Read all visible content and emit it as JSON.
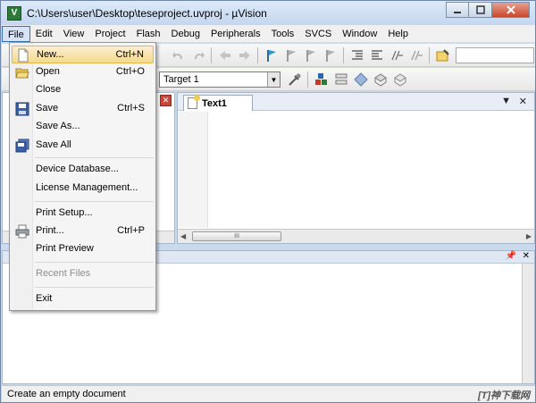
{
  "window": {
    "title": "C:\\Users\\user\\Desktop\\teseproject.uvproj - µVision",
    "app_icon_letter": "V"
  },
  "menubar": {
    "items": [
      "File",
      "Edit",
      "View",
      "Project",
      "Flash",
      "Debug",
      "Peripherals",
      "Tools",
      "SVCS",
      "Window",
      "Help"
    ],
    "active": "File"
  },
  "toolbar2": {
    "target": "Target 1"
  },
  "editor": {
    "tab_label": "Text1",
    "tab_menu_glyph": "▼",
    "tab_close_glyph": "✕",
    "scroll_thumb_grip": "III"
  },
  "file_menu": {
    "items": [
      {
        "label": "New...",
        "shortcut": "Ctrl+N",
        "icon": "new-file-icon",
        "highlighted": true
      },
      {
        "label": "Open",
        "shortcut": "Ctrl+O",
        "icon": "open-folder-icon"
      },
      {
        "label": "Close",
        "shortcut": ""
      },
      {
        "label": "Save",
        "shortcut": "Ctrl+S",
        "icon": "save-icon"
      },
      {
        "label": "Save As...",
        "shortcut": ""
      },
      {
        "label": "Save All",
        "shortcut": "",
        "icon": "save-all-icon"
      },
      {
        "label": "Device Database...",
        "shortcut": ""
      },
      {
        "label": "License Management...",
        "shortcut": ""
      },
      {
        "label": "Print Setup...",
        "shortcut": ""
      },
      {
        "label": "Print...",
        "shortcut": "Ctrl+P",
        "icon": "printer-icon"
      },
      {
        "label": "Print Preview",
        "shortcut": ""
      },
      {
        "label": "Recent Files",
        "shortcut": "",
        "disabled": true
      },
      {
        "label": "Exit",
        "shortcut": ""
      }
    ]
  },
  "statusbar": {
    "text": "Create an empty document"
  },
  "watermark": "[T]神下载网",
  "colors": {
    "highlight": "#f6d98f",
    "title_gradient": "#c4d7ef",
    "close_button": "#c9452c"
  }
}
